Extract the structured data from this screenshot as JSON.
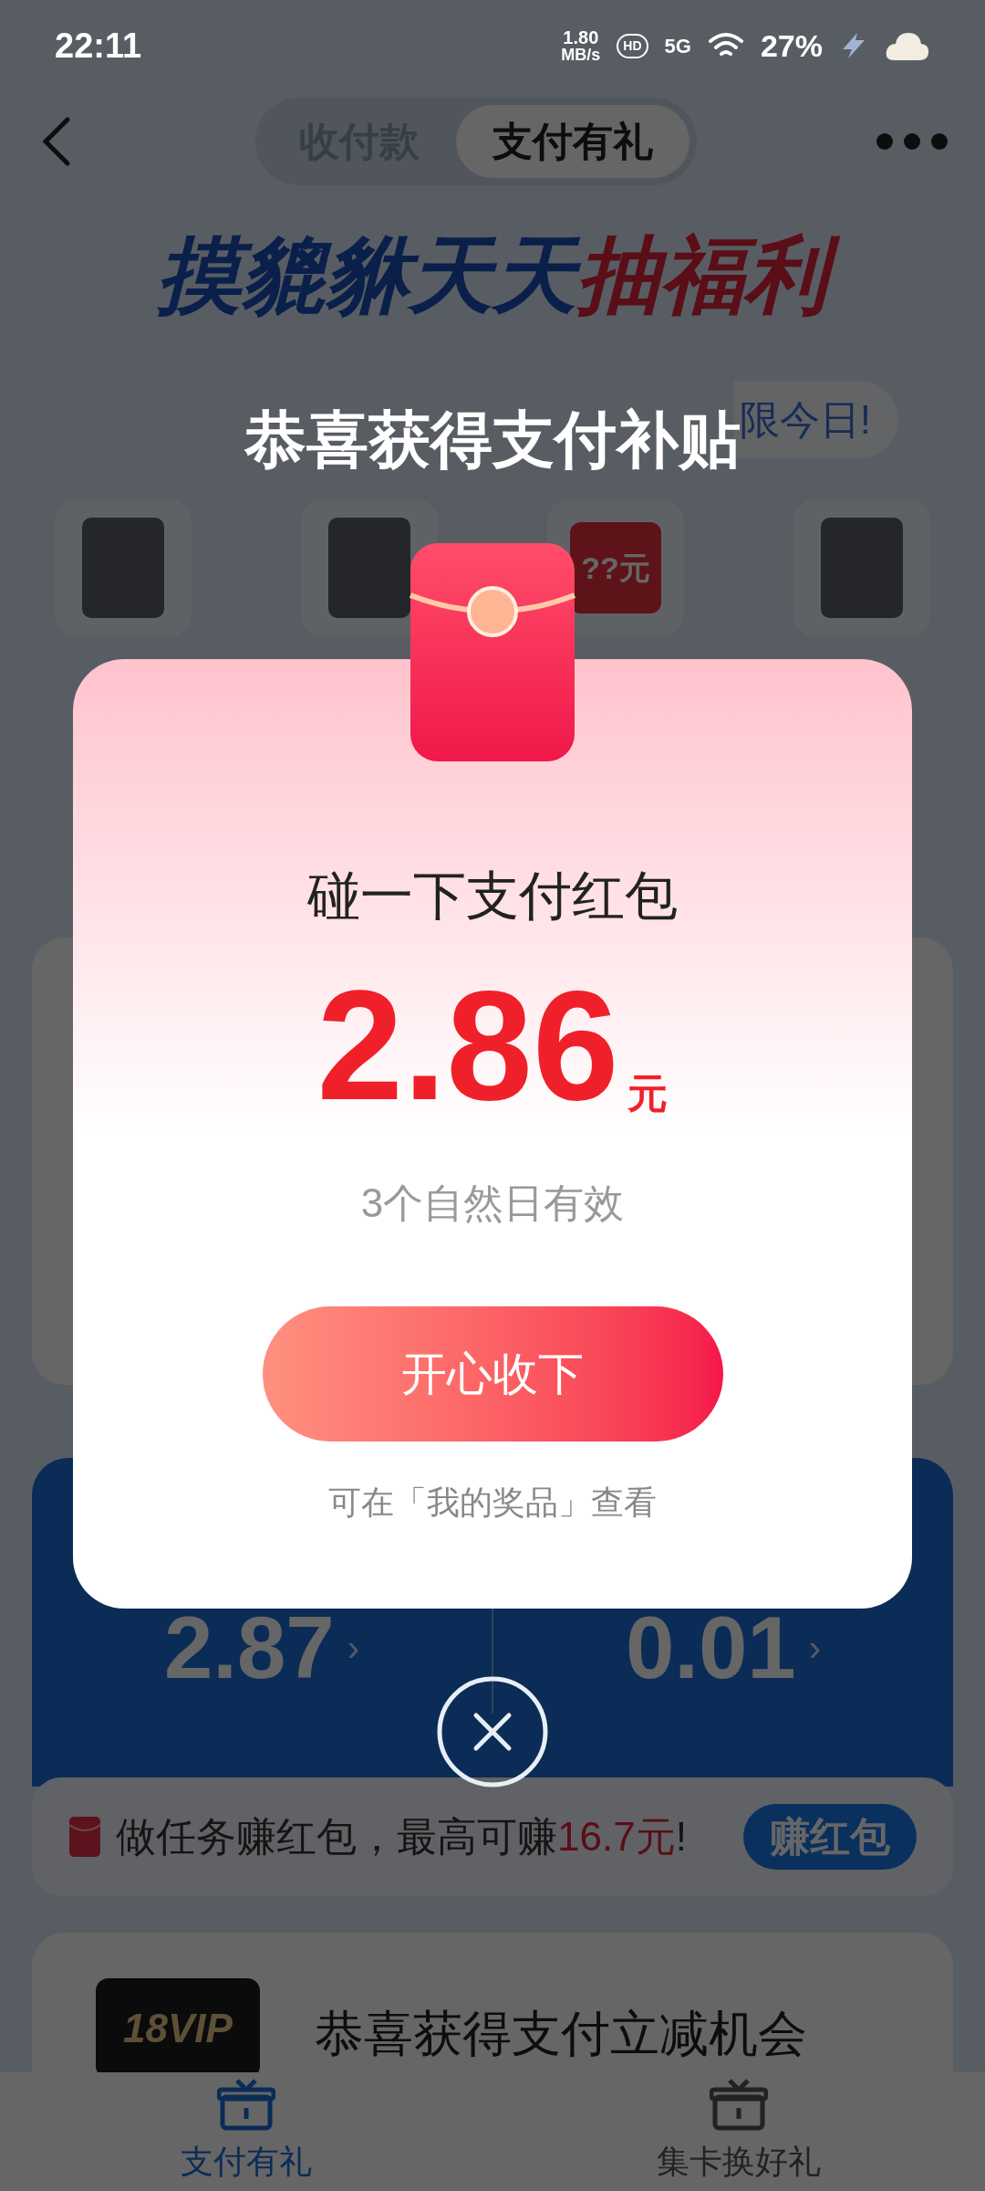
{
  "status_bar": {
    "time": "22:11",
    "speed_value": "1.80",
    "speed_unit": "MB/s",
    "hd": "HD",
    "network": "5G",
    "battery": "27%"
  },
  "header": {
    "tabs": [
      {
        "label": "收付款",
        "selected": false
      },
      {
        "label": "支付有礼",
        "selected": true
      }
    ]
  },
  "banner": {
    "title_part_1": "摸貔貅天天",
    "title_part_2": "抽福利",
    "pill_text": "限今日!"
  },
  "prizes": [
    {
      "kind": "photo"
    },
    {
      "kind": "photo"
    },
    {
      "kind": "mystery",
      "label": "??元"
    },
    {
      "kind": "photo"
    }
  ],
  "stats": [
    {
      "value": "2.87",
      "arrow": "›"
    },
    {
      "value": "0.01",
      "arrow": "›"
    }
  ],
  "task_bar": {
    "text": "做任务赚红包，最高可赚",
    "highlight": "16.7元",
    "suffix": "!",
    "button": "赚红包"
  },
  "promo_card": {
    "badge": "18VIP",
    "title": "恭喜获得支付立减机会"
  },
  "bottom_nav": [
    {
      "label": "支付有礼",
      "selected": true
    },
    {
      "label": "集卡换好礼",
      "selected": false
    }
  ],
  "modal": {
    "headline": "恭喜获得支付补贴",
    "title": "碰一下支付红包",
    "amount": "2.86",
    "unit": "元",
    "validity": "3个自然日有效",
    "button": "开心收下",
    "note": "可在「我的奖品」查看"
  }
}
